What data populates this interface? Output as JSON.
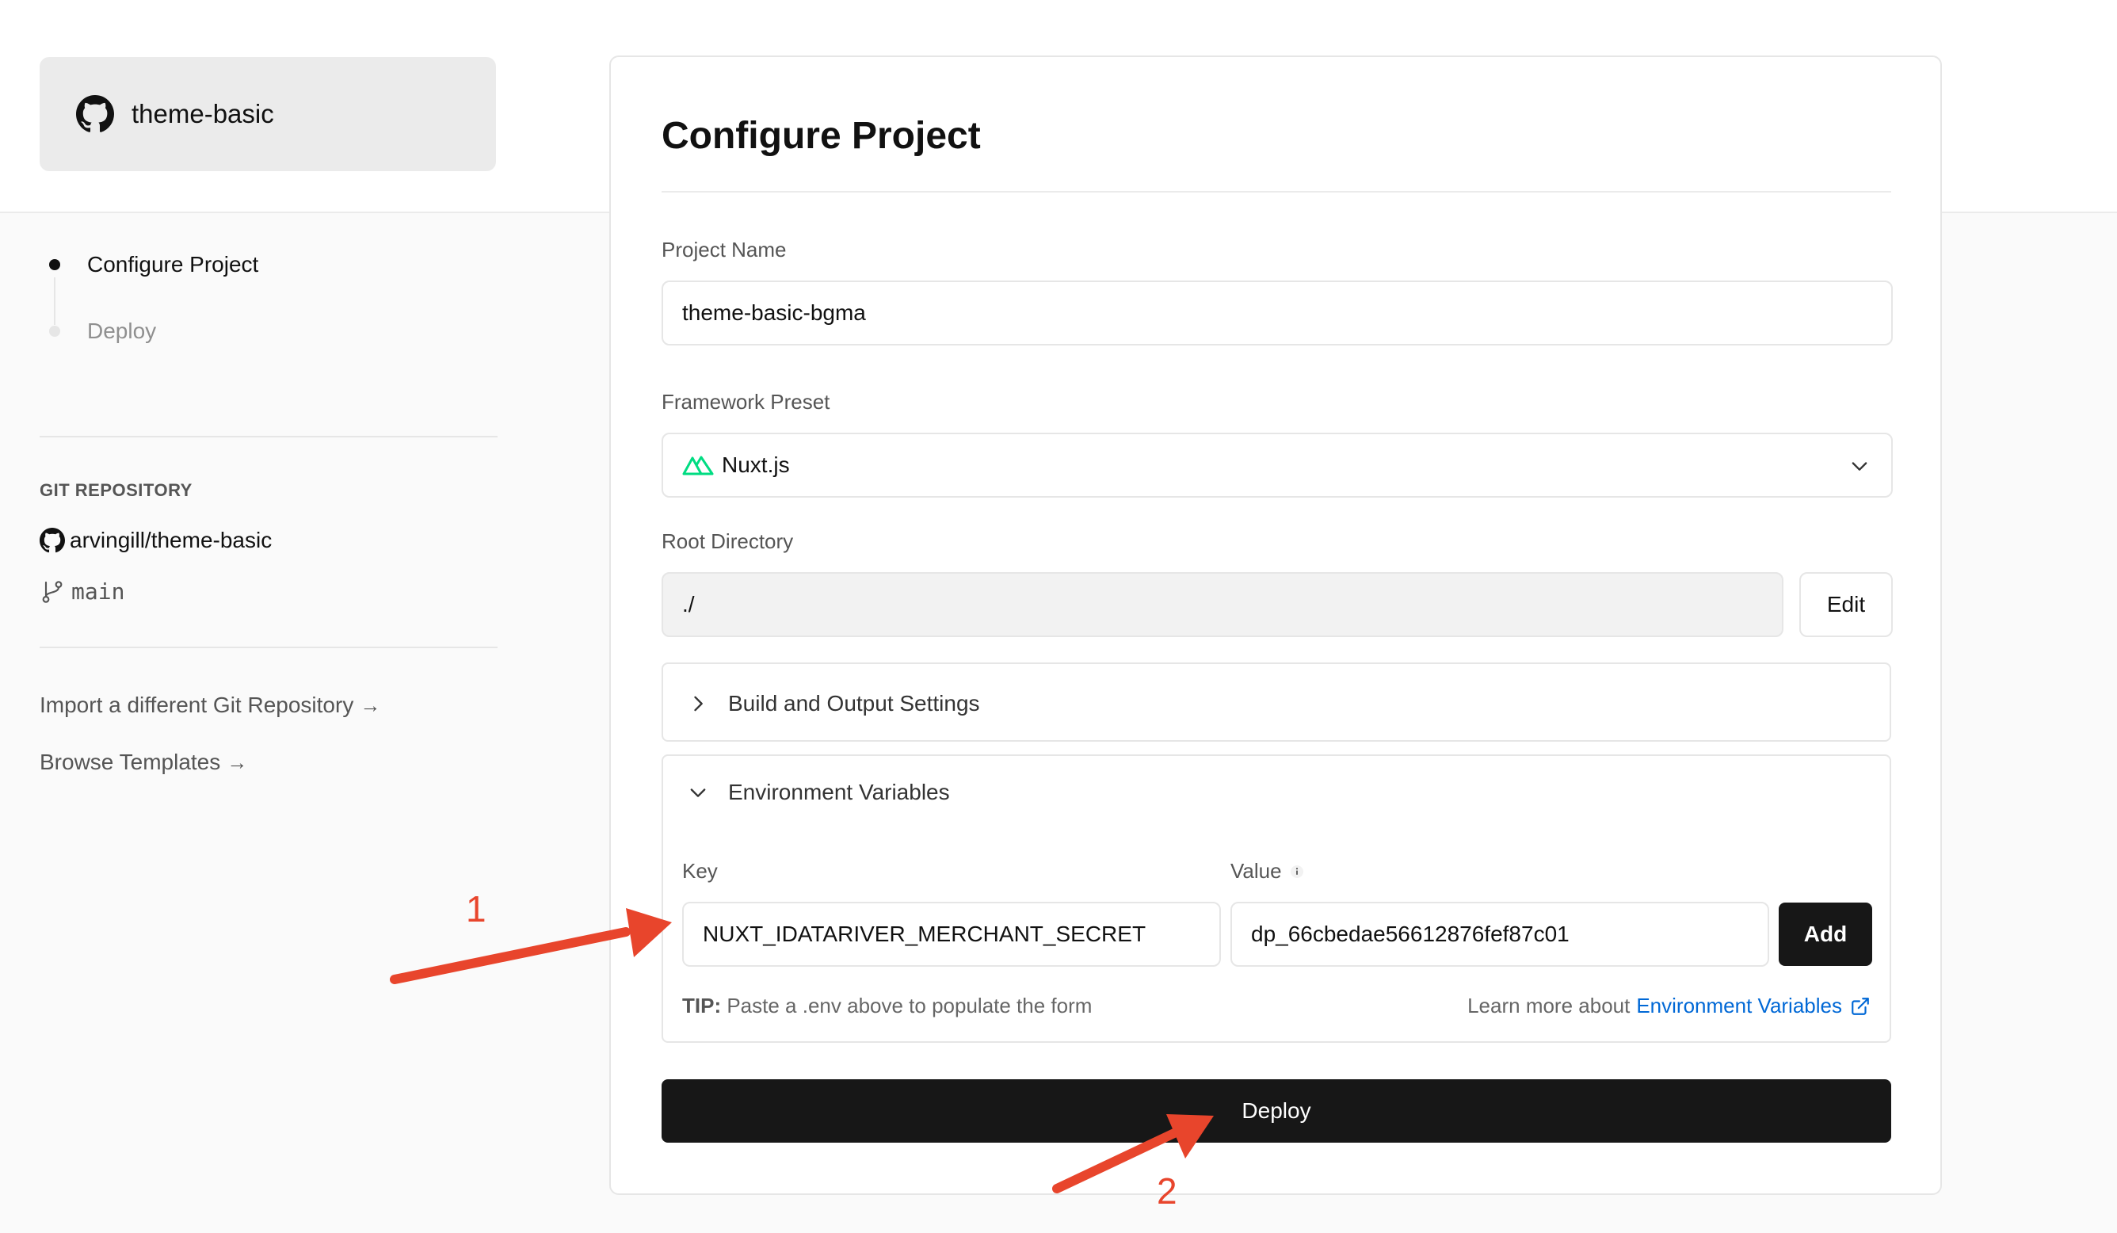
{
  "repo_card": {
    "name": "theme-basic",
    "icon": "github-icon"
  },
  "steps": [
    {
      "label": "Configure Project",
      "state": "active"
    },
    {
      "label": "Deploy",
      "state": "pending"
    }
  ],
  "git": {
    "heading": "GIT REPOSITORY",
    "repo": "arvingill/theme-basic",
    "branch": "main"
  },
  "side_links": [
    {
      "label": "Import a different Git Repository",
      "arrow": "→"
    },
    {
      "label": "Browse Templates",
      "arrow": "→"
    }
  ],
  "configure": {
    "title": "Configure Project",
    "project_name_label": "Project Name",
    "project_name_value": "theme-basic-bgma",
    "framework_label": "Framework Preset",
    "framework_value": "Nuxt.js",
    "root_label": "Root Directory",
    "root_value": "./",
    "edit_label": "Edit",
    "build_section": "Build and Output Settings",
    "env_section": "Environment Variables",
    "env": {
      "key_label": "Key",
      "value_label": "Value",
      "key_value": "NUXT_IDATARIVER_MERCHANT_SECRET",
      "value_value": "dp_66cbedae56612876fef87c01",
      "add_label": "Add",
      "tip_bold": "TIP:",
      "tip_text": "Paste a .env above to populate the form",
      "learn_prefix": "Learn more about",
      "learn_link": "Environment Variables"
    },
    "deploy_label": "Deploy"
  },
  "annotations": {
    "marker_1": "1",
    "marker_2": "2",
    "color": "#e8452c"
  },
  "colors": {
    "primary_button": "#171717",
    "link": "#0068d6",
    "nuxt_green": "#00dc82"
  }
}
